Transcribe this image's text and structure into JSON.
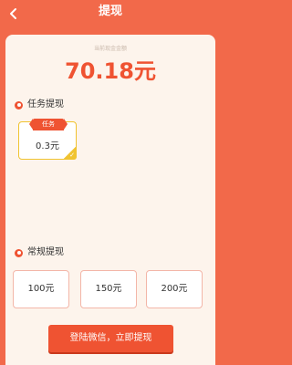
{
  "header": {
    "title": "提现",
    "back_icon": "chevron-left-icon"
  },
  "balance": {
    "label": "当前现金金额",
    "value": "70.18元"
  },
  "task_section": {
    "title": "任务提现",
    "options": [
      {
        "tag": "任务",
        "amount": "0.3元",
        "selected": true
      }
    ]
  },
  "regular_section": {
    "title": "常规提现",
    "options": [
      {
        "amount": "100元"
      },
      {
        "amount": "150元"
      },
      {
        "amount": "200元"
      }
    ]
  },
  "action": {
    "withdraw_label": "登陆微信，立即提现"
  },
  "colors": {
    "accent": "#ef5332",
    "background": "#f2694a",
    "card": "#fdf4ec",
    "selected_border": "#f0c330"
  }
}
